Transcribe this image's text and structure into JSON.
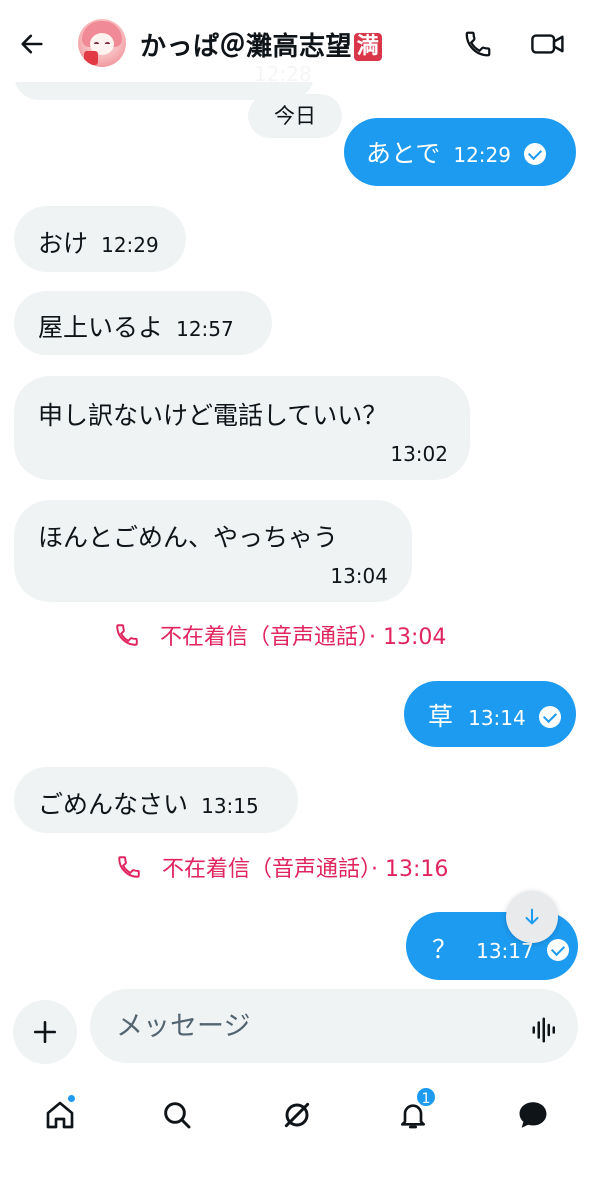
{
  "header": {
    "contact_name": "かっぱ＠灘高志望",
    "badge_glyph": "満"
  },
  "chat": {
    "date_separator": "今日",
    "previous_time_partial": "12:28",
    "messages": [
      {
        "dir": "out",
        "text": "あとで",
        "time": "12:29",
        "read": true
      },
      {
        "dir": "in",
        "text": "おけ",
        "time": "12:29"
      },
      {
        "dir": "in",
        "text": "屋上いるよ",
        "time": "12:57"
      },
      {
        "dir": "in",
        "text": "申し訳ないけど電話していい？",
        "time": "13:02"
      },
      {
        "dir": "in",
        "text": "ほんとごめん、やっちゃう",
        "time": "13:04"
      },
      {
        "dir": "missed_call",
        "text": "不在着信（音声通話）· 13:04"
      },
      {
        "dir": "out",
        "text": "草",
        "time": "13:14",
        "read": true
      },
      {
        "dir": "in",
        "text": "ごめんなさい",
        "time": "13:15"
      },
      {
        "dir": "missed_call",
        "text": "不在着信（音声通話）· 13:16"
      },
      {
        "dir": "out",
        "text": "？",
        "time": "13:17",
        "read": true
      }
    ]
  },
  "composer": {
    "placeholder": "メッセージ"
  },
  "nav": {
    "notifications_count": "1"
  },
  "colors": {
    "accent": "#1d9bf0",
    "incoming_bubble": "#eff3f4",
    "missed_call": "#e0245e"
  }
}
